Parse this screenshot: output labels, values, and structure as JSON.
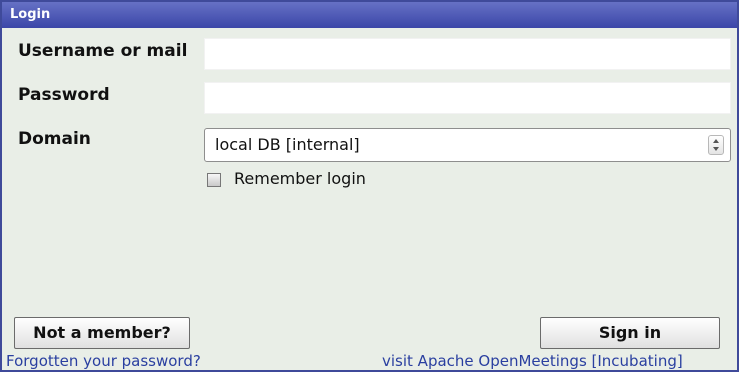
{
  "titlebar": {
    "title": "Login"
  },
  "form": {
    "username_label": "Username or mail",
    "username_value": "",
    "password_label": "Password",
    "password_value": "",
    "domain_label": "Domain",
    "domain_value": "local DB [internal]",
    "remember_label": "Remember login",
    "remember_checked": false
  },
  "buttons": {
    "not_member": "Not a member?",
    "sign_in": "Sign in"
  },
  "links": {
    "forgot": "Forgotten your password?",
    "visit": "visit Apache OpenMeetings [Incubating]"
  },
  "icons": {
    "domain_select_arrows": "up-down-arrows-icon"
  },
  "colors": {
    "titlebar": "#3b46a8",
    "panel": "#e9eee7",
    "link": "#2a3fa0"
  }
}
